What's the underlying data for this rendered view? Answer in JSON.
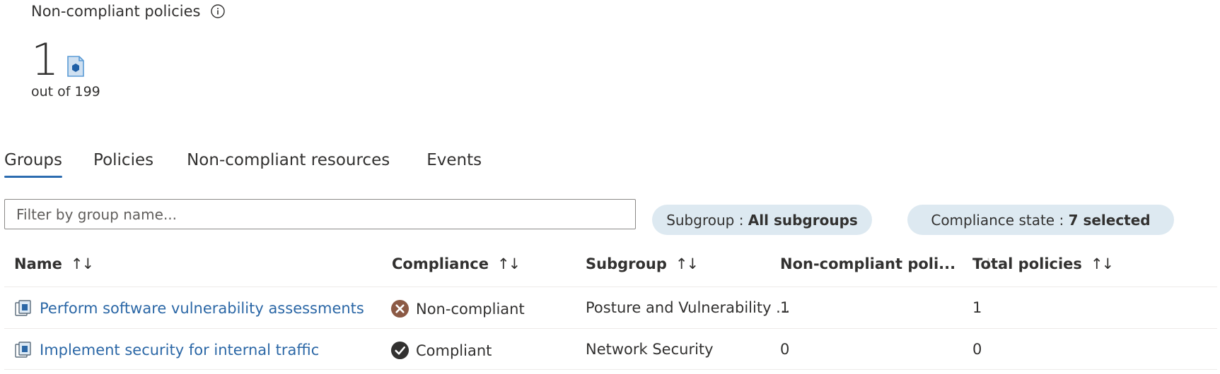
{
  "summary": {
    "title": "Non-compliant policies",
    "count": "1",
    "sub": "out of 199",
    "info_icon": "info-icon",
    "policy_icon": "policy-document-icon"
  },
  "tabs": [
    {
      "label": "Groups",
      "active": true
    },
    {
      "label": "Policies",
      "active": false
    },
    {
      "label": "Non-compliant resources",
      "active": false
    },
    {
      "label": "Events",
      "active": false
    }
  ],
  "filter": {
    "placeholder": "Filter by group name..."
  },
  "pills": {
    "subgroup": {
      "key": "Subgroup : ",
      "value": "All subgroups"
    },
    "compliance": {
      "key": "Compliance state : ",
      "value": "7 selected"
    }
  },
  "table": {
    "columns": {
      "name": "Name",
      "compliance": "Compliance",
      "subgroup": "Subgroup",
      "noncompliant": "Non-compliant poli...",
      "total": "Total policies"
    },
    "sort_glyph": "↑↓",
    "rows": [
      {
        "name": "Perform software vulnerability assessments",
        "compliance": "Non-compliant",
        "compliance_icon": "error-circle-icon",
        "subgroup": "Posture and Vulnerability ...",
        "noncompliant": "1",
        "total": "1"
      },
      {
        "name": "Implement security for internal traffic",
        "compliance": "Compliant",
        "compliance_icon": "check-circle-icon",
        "subgroup": "Network Security",
        "noncompliant": "0",
        "total": "0"
      }
    ]
  },
  "colors": {
    "link": "#2b67a6",
    "accent": "#2b6cb0",
    "pill_bg": "#dde9f1",
    "error": "#8c5a45",
    "ok": "#323130"
  }
}
